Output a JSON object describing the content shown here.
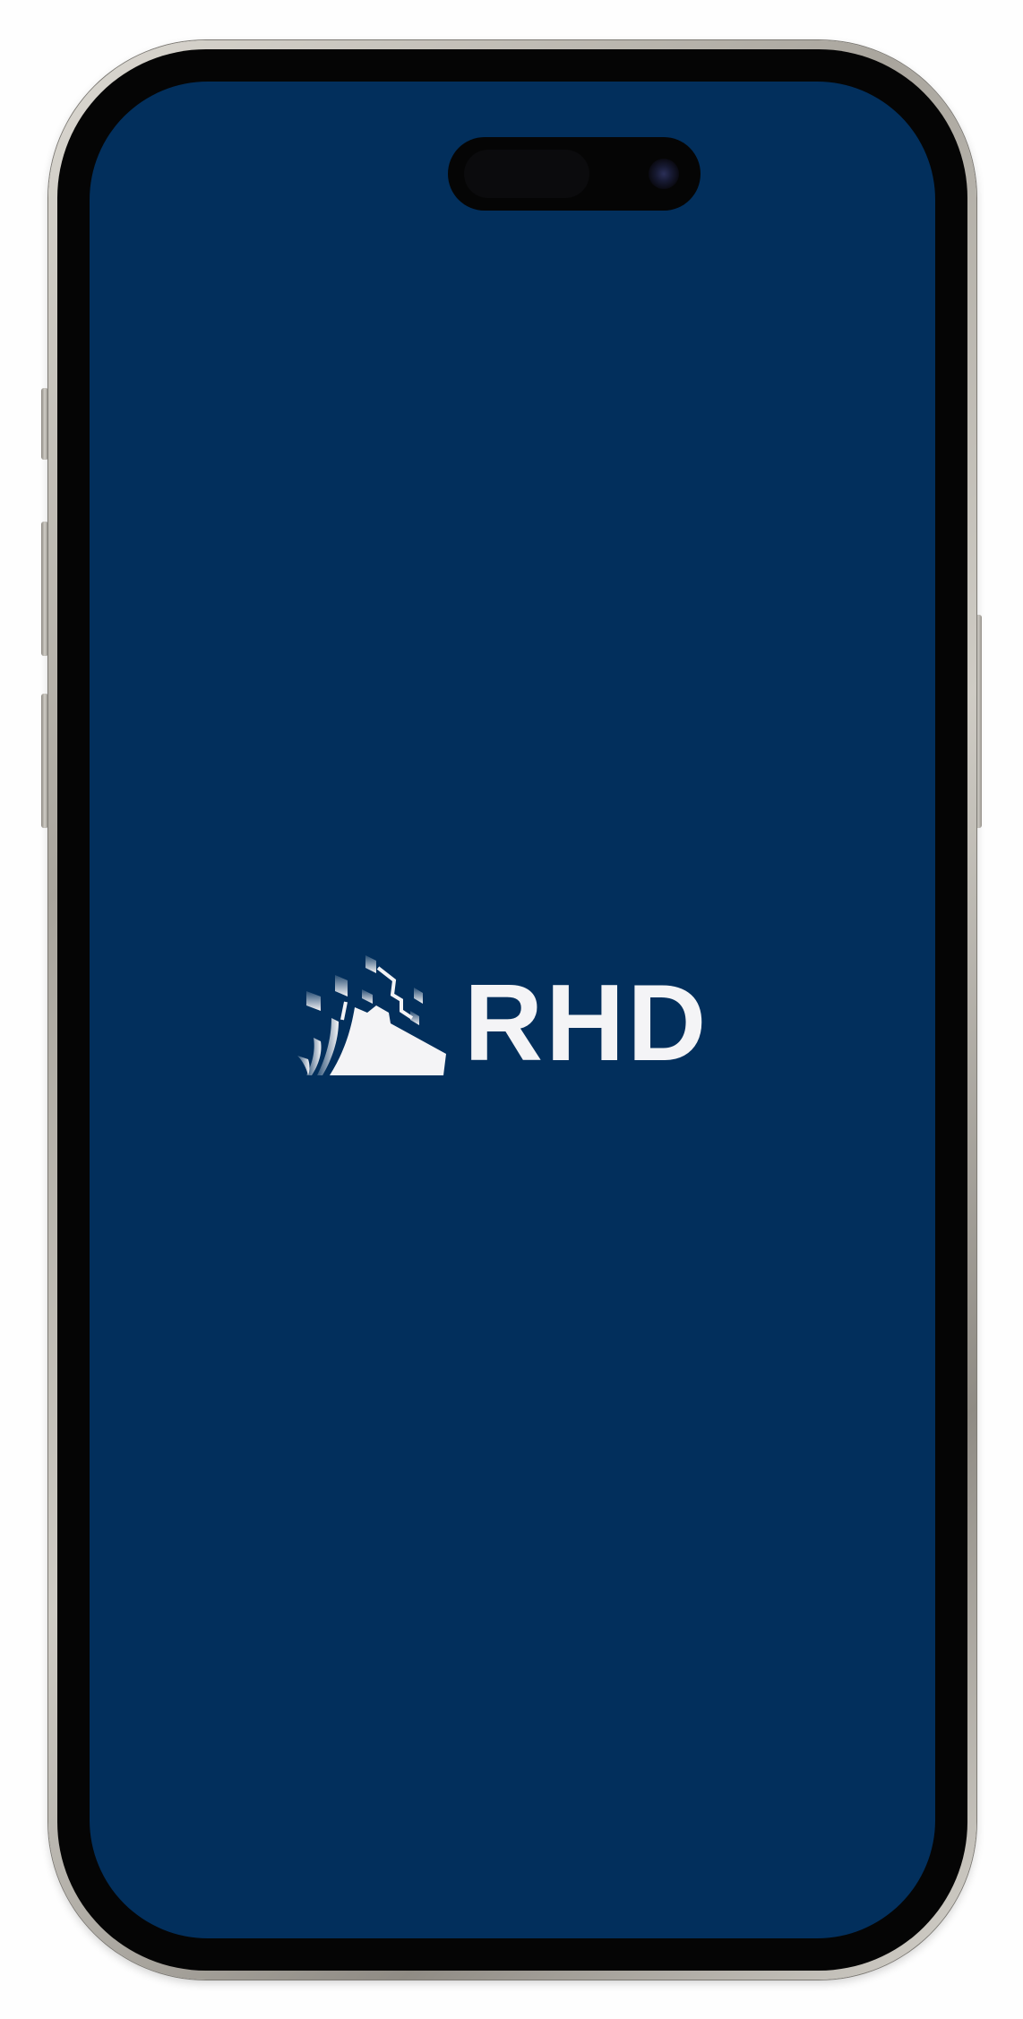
{
  "app": {
    "brand_name": "RHD",
    "logo_icon": "rhd-emblem-icon"
  },
  "colors": {
    "screen_background": "#022f5c",
    "logo_foreground": "#f4f4f6",
    "frame": "#cfccc5"
  }
}
